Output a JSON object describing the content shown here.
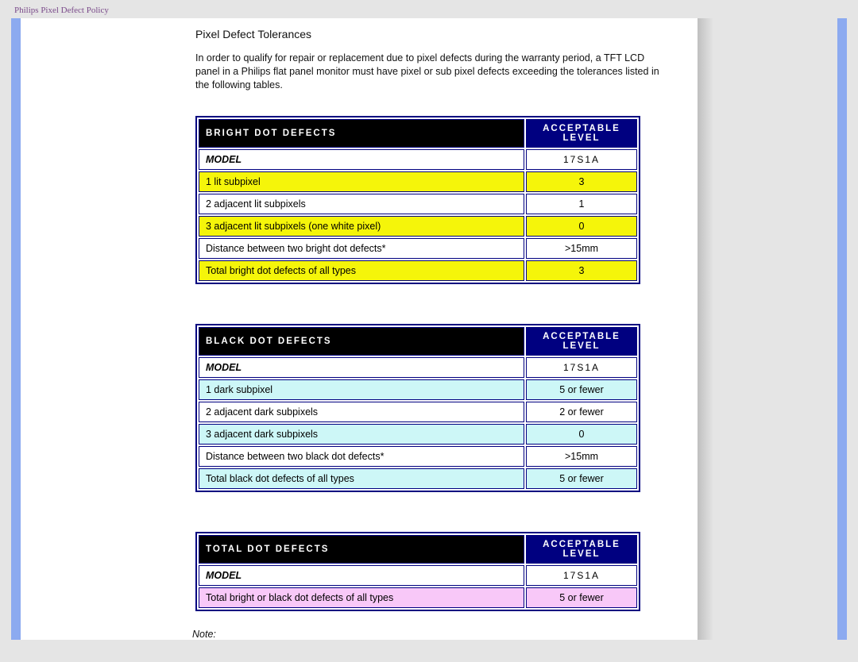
{
  "header": {
    "title": "Philips Pixel Defect Policy"
  },
  "main": {
    "title": "Pixel Defect Tolerances",
    "intro": "In order to qualify for repair or replacement due to pixel defects during the warranty period, a TFT LCD panel in a Philips flat panel monitor must have pixel or sub pixel defects exceeding the tolerances listed in the following tables.",
    "note": "Note:"
  },
  "tables": {
    "bright": {
      "hdr_left": "BRIGHT DOT DEFECTS",
      "hdr_right": "ACCEPTABLE LEVEL",
      "model_label": "MODEL",
      "model_value": "17S1A",
      "rows": [
        {
          "label": "1 lit subpixel",
          "value": "3",
          "hl": "yellow"
        },
        {
          "label": "2 adjacent lit subpixels",
          "value": "1",
          "hl": "white"
        },
        {
          "label": "3 adjacent lit subpixels (one white pixel)",
          "value": "0",
          "hl": "yellow"
        },
        {
          "label": "Distance between two bright dot defects*",
          "value": ">15mm",
          "hl": "white"
        },
        {
          "label": "Total bright dot defects of all types",
          "value": "3",
          "hl": "yellow"
        }
      ]
    },
    "black": {
      "hdr_left": "BLACK DOT DEFECTS",
      "hdr_right": "ACCEPTABLE LEVEL",
      "model_label": "MODEL",
      "model_value": "17S1A",
      "rows": [
        {
          "label": "1 dark subpixel",
          "value": "5 or fewer",
          "hl": "cyan"
        },
        {
          "label": "2 adjacent dark subpixels",
          "value": "2 or fewer",
          "hl": "white"
        },
        {
          "label": "3 adjacent dark subpixels",
          "value": "0",
          "hl": "cyan"
        },
        {
          "label": "Distance between two black dot defects*",
          "value": ">15mm",
          "hl": "white"
        },
        {
          "label": "Total black dot defects of all types",
          "value": "5 or fewer",
          "hl": "cyan"
        }
      ]
    },
    "total": {
      "hdr_left": "TOTAL DOT DEFECTS",
      "hdr_right": "ACCEPTABLE LEVEL",
      "model_label": "MODEL",
      "model_value": "17S1A",
      "rows": [
        {
          "label": "Total bright or black dot defects of all types",
          "value": "5 or fewer",
          "hl": "violet"
        }
      ]
    }
  }
}
